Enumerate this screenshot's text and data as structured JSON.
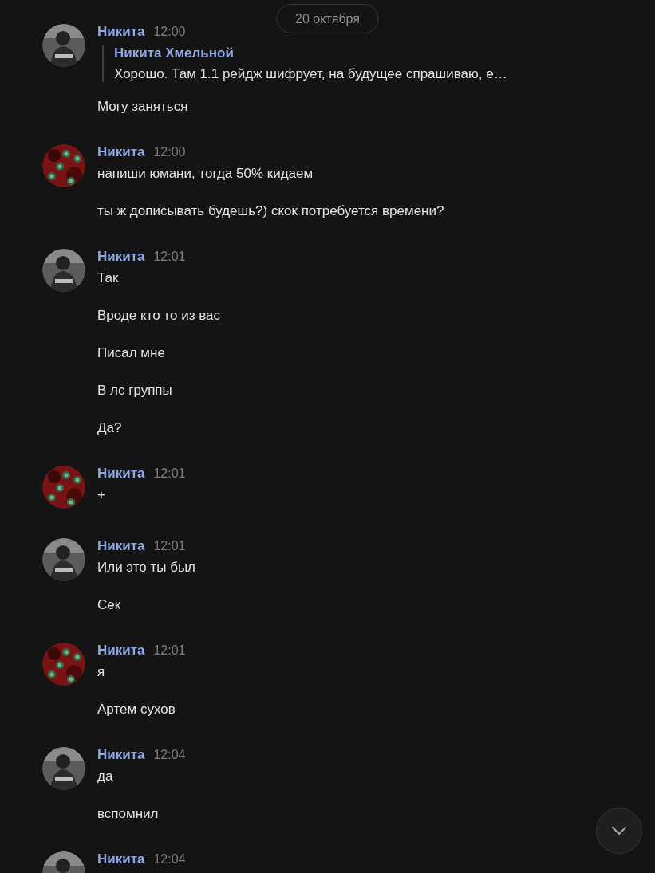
{
  "date_pill": "20 октября",
  "groups": [
    {
      "author": "Никита",
      "time": "12:00",
      "avatar": {
        "kind": "picture",
        "color": "#5c5c5c"
      },
      "quote": {
        "author": "Никита Хмельной",
        "text": "Хорошо. Там 1.1 рейдж шифрует, на будущее спрашиваю, е…"
      },
      "messages": [
        "Могу заняться"
      ]
    },
    {
      "author": "Никита",
      "time": "12:00",
      "avatar": {
        "kind": "picture",
        "color": "#7a1414"
      },
      "messages": [
        "напиши юмани, тогда 50% кидаем",
        "ты ж дописывать будешь?) скок потребуется времени?"
      ]
    },
    {
      "author": "Никита",
      "time": "12:01",
      "avatar": {
        "kind": "picture",
        "color": "#5c5c5c"
      },
      "messages": [
        "Так",
        "Вроде кто то из вас",
        "Писал мне",
        "В лс группы",
        "Да?"
      ]
    },
    {
      "author": "Никита",
      "time": "12:01",
      "avatar": {
        "kind": "picture",
        "color": "#7a1414"
      },
      "messages": [
        "+"
      ]
    },
    {
      "author": "Никита",
      "time": "12:01",
      "avatar": {
        "kind": "picture",
        "color": "#5c5c5c"
      },
      "messages": [
        "Или это ты был",
        "Сек"
      ]
    },
    {
      "author": "Никита",
      "time": "12:01",
      "avatar": {
        "kind": "picture",
        "color": "#7a1414"
      },
      "messages": [
        "я",
        "Артем сухов"
      ]
    },
    {
      "author": "Никита",
      "time": "12:04",
      "avatar": {
        "kind": "picture",
        "color": "#5c5c5c"
      },
      "messages": [
        "да",
        "вспомнил"
      ]
    },
    {
      "author": "Никита",
      "time": "12:04",
      "avatar": {
        "kind": "picture",
        "color": "#5c5c5c"
      }
    }
  ]
}
